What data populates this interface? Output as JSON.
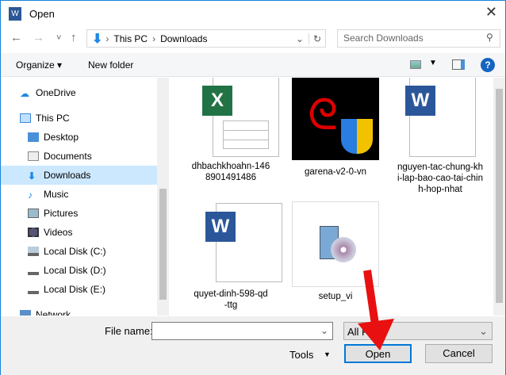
{
  "window": {
    "title": "Open"
  },
  "nav": {
    "back": "←",
    "forward": "→",
    "recent": "˅",
    "up": "↑",
    "breadcrumb": [
      "This PC",
      "Downloads"
    ],
    "refresh": "↻",
    "search_placeholder": "Search Downloads"
  },
  "toolbar": {
    "organize": "Organize ▾",
    "new_folder": "New folder",
    "help": "?"
  },
  "sidebar": {
    "items": [
      {
        "label": "OneDrive"
      },
      {
        "label": "This PC"
      },
      {
        "label": "Desktop"
      },
      {
        "label": "Documents"
      },
      {
        "label": "Downloads"
      },
      {
        "label": "Music"
      },
      {
        "label": "Pictures"
      },
      {
        "label": "Videos"
      },
      {
        "label": "Local Disk (C:)"
      },
      {
        "label": "Local Disk (D:)"
      },
      {
        "label": "Local Disk (E:)"
      },
      {
        "label": "Network"
      }
    ]
  },
  "files": [
    {
      "name": "dhbachkhoahn-1468901491486",
      "type": "excel",
      "badge": "X"
    },
    {
      "name": "garena-v2-0-vn",
      "type": "app"
    },
    {
      "name": "nguyen-tac-chung-khi-lap-bao-cao-tai-chinh-hop-nhat",
      "type": "word",
      "badge": "W"
    },
    {
      "name": "quyet-dinh-598-qd-ttg",
      "type": "word",
      "badge": "W"
    },
    {
      "name": "setup_vi",
      "type": "installer"
    }
  ],
  "bottom": {
    "file_name_label": "File name:",
    "file_name_value": "",
    "file_type": "All Files",
    "tools": "Tools",
    "open": "Open",
    "cancel": "Cancel"
  },
  "colors": {
    "accent": "#0078d7",
    "arrow": "#e81010"
  }
}
